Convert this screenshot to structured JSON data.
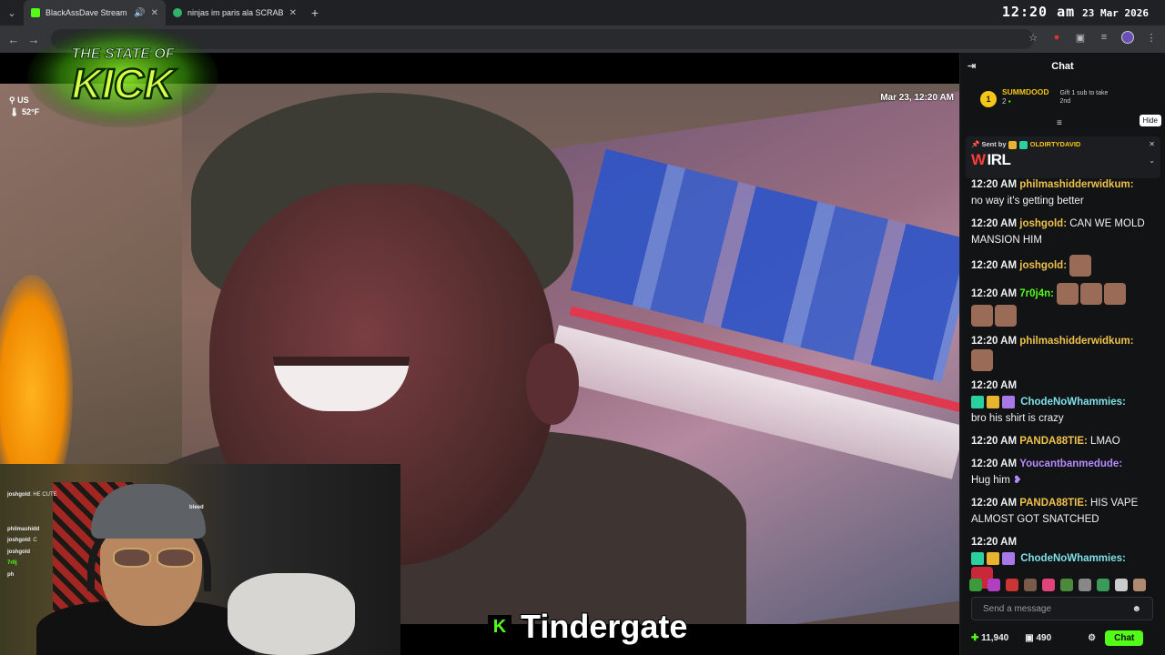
{
  "tabs": [
    {
      "label": "BlackAssDave Stream - Wat",
      "active": true,
      "color": "#53fc18"
    },
    {
      "label": "ninjas im paris ala SCRABSNYC",
      "active": false,
      "color": "#2fb36a"
    }
  ],
  "clock": {
    "time": "12:20 am",
    "date": "23 Mar 2026"
  },
  "logo": {
    "line1": "THE STATE OF",
    "line2": "KICK"
  },
  "stream": {
    "location": "US",
    "temperature": "52°F",
    "timestamp": "Mar 23, 12:20 AM"
  },
  "webcam_chat": {
    "lines": [
      {
        "user": "joshgold",
        "text": "HE CUTE"
      },
      {
        "user": "",
        "text": ""
      },
      {
        "user": "",
        "text": ""
      },
      {
        "user": "philmashidd",
        "text": ""
      },
      {
        "user": "joshgold",
        "text": "C"
      },
      {
        "user": "joshgold",
        "text": ""
      },
      {
        "user": "7r0j",
        "text": ""
      },
      {
        "user": "ph",
        "text": ""
      }
    ],
    "bleed_text": "bleed"
  },
  "caption": {
    "logo_letter": "K",
    "text": "Tindergate"
  },
  "chat": {
    "title": "Chat",
    "leaderboard": {
      "rank": "1",
      "name": "SUMMDOOD",
      "count": "2",
      "gift_text": "Gift 1 sub to take 2nd"
    },
    "hide_label": "Hide",
    "pinned": {
      "sent_by_label": "Sent by",
      "sender": "OLDIRTYDAVID",
      "text": "IRL"
    },
    "messages": [
      {
        "time": "12:20 AM",
        "user": "philmashidderwidkum:",
        "color": "gold",
        "text": "no way it's getting better"
      },
      {
        "time": "12:20 AM",
        "user": "joshgold:",
        "color": "gold",
        "text": "CAN WE MOLD MANSION HIM"
      },
      {
        "time": "12:20 AM",
        "user": "joshgold:",
        "color": "gold",
        "text": ""
      },
      {
        "time": "12:20 AM",
        "user": "7r0j4n:",
        "color": "green",
        "text": ""
      },
      {
        "time": "12:20 AM",
        "user": "philmashidderwidkum:",
        "color": "gold",
        "text": ""
      },
      {
        "time": "12:20 AM",
        "user": "ChodeNoWhammies:",
        "color": "teal",
        "text": "bro his shirt is crazy"
      },
      {
        "time": "12:20 AM",
        "user": "PANDA88TIE:",
        "color": "gold",
        "text": "LMAO"
      },
      {
        "time": "12:20 AM",
        "user": "Youcantbanmedude:",
        "color": "purple",
        "text": "Hug him"
      },
      {
        "time": "12:20 AM",
        "user": "PANDA88TIE:",
        "color": "gold",
        "text": "HIS VAPE ALMOST GOT SNATCHED"
      },
      {
        "time": "12:20 AM",
        "user": "ChodeNoWhammies:",
        "color": "teal",
        "text": ""
      }
    ],
    "send_placeholder": "Send a message",
    "points": "11,940",
    "gifts": "490",
    "chat_button": "Chat"
  }
}
